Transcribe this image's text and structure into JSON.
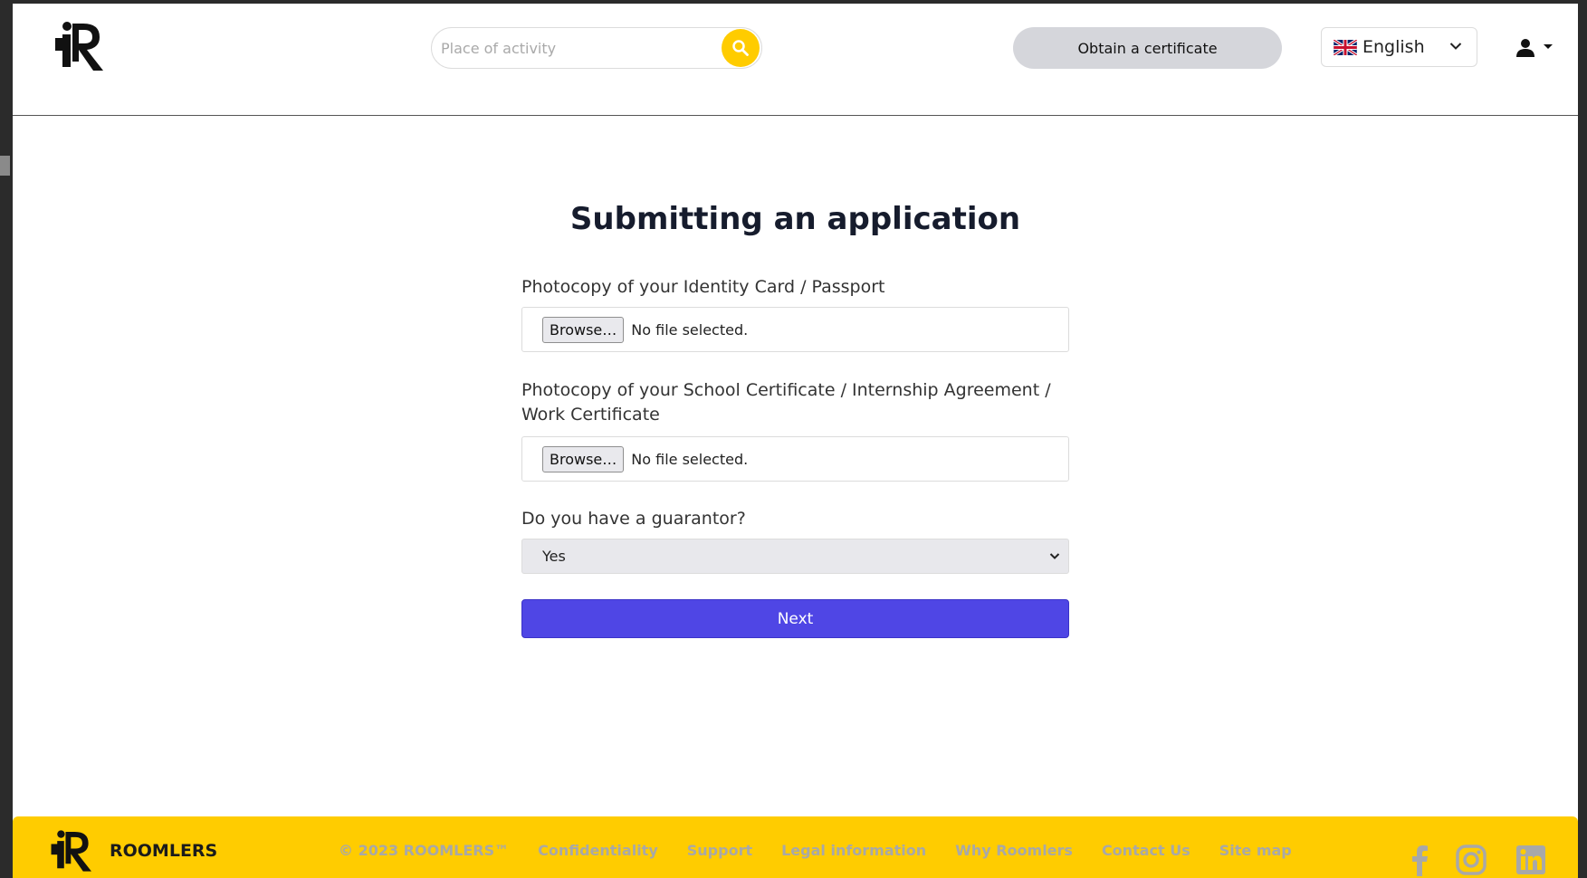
{
  "header": {
    "search_placeholder": "Place of activity",
    "certificate_button": "Obtain a certificate",
    "language": "English"
  },
  "main": {
    "title": "Submitting an application",
    "fields": [
      {
        "label": "Photocopy of your Identity Card / Passport",
        "button": "Browse…",
        "status": "No file selected."
      },
      {
        "label": "Photocopy of your School Certificate / Internship Agreement / Work Certificate",
        "button": "Browse…",
        "status": "No file selected."
      }
    ],
    "guarantor": {
      "label": "Do you have a guarantor?",
      "value": "Yes"
    },
    "next_button": "Next"
  },
  "footer": {
    "brand": "ROOMLERS",
    "copyright": "© 2023 ROOMLERS™",
    "links": [
      "Confidentiality",
      "Support",
      "Legal information",
      "Why Roomlers",
      "Contact Us",
      "Site map"
    ],
    "social_icons": [
      "facebook-icon",
      "instagram-icon",
      "linkedin-icon"
    ]
  },
  "colors": {
    "accent_yellow": "#ffcc00",
    "primary_button": "#4f46e5",
    "certificate_button_bg": "#d5d6db"
  }
}
